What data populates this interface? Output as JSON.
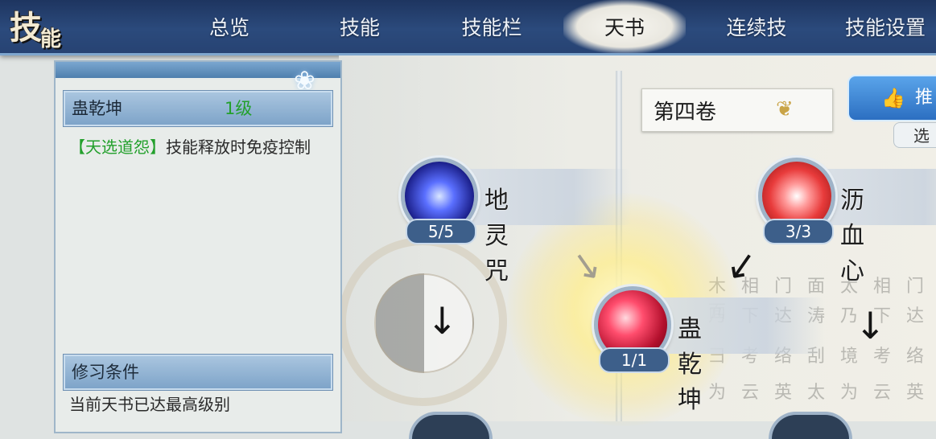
{
  "nav": {
    "logo_char1": "技",
    "logo_char2": "能",
    "tabs": [
      {
        "label": "总览",
        "active": false
      },
      {
        "label": "技能",
        "active": false
      },
      {
        "label": "技能栏",
        "active": false
      },
      {
        "label": "天书",
        "active": true
      },
      {
        "label": "连续技",
        "active": false
      },
      {
        "label": "技能设置",
        "active": false
      }
    ]
  },
  "skill_info": {
    "name": "蛊乾坤",
    "level": "1级",
    "desc_tag": "【天选道怨】",
    "desc_text": "技能释放时免疫控制",
    "cond_header": "修习条件",
    "cond_text": "当前天书已达最高级别"
  },
  "volume": {
    "label": "第四卷",
    "icon": "lotus-icon"
  },
  "recommend": {
    "label": "推",
    "sub": "选",
    "icon": "thumbs-up-icon"
  },
  "skills": [
    {
      "name": "地灵咒",
      "count": "5/5",
      "icon": "blue-energy-orb-icon"
    },
    {
      "name": "沥血心",
      "count": "3/3",
      "icon": "red-flower-orb-icon"
    },
    {
      "name": "蛊乾坤",
      "count": "1/1",
      "icon": "crimson-swirl-orb-icon"
    }
  ],
  "colors": {
    "nav_bg": "#2b4a7c",
    "accent_green": "#23a02c",
    "panel_header": "#7ea4c9",
    "count_badge": "#3d5f8a"
  }
}
